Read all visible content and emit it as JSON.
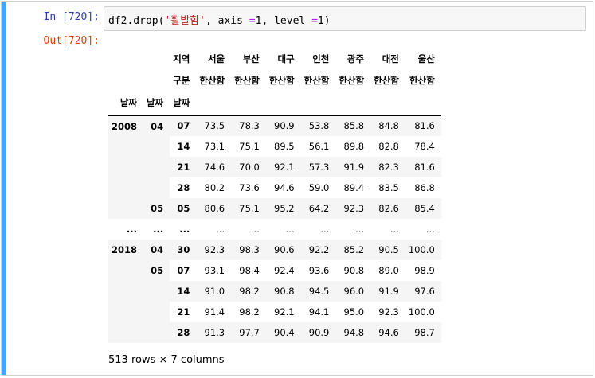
{
  "cell": {
    "in_prompt": "In [720]:",
    "out_prompt": "Out[720]:",
    "code": {
      "pre": "df2.drop(",
      "str_arg": "'활발함'",
      "mid1": ", axis ",
      "op1": "=",
      "mid2": "1, level ",
      "op2": "=",
      "post": "1)"
    }
  },
  "table": {
    "col_level0_label": "지역",
    "col_level1_label": "구분",
    "regions": [
      "서울",
      "부산",
      "대구",
      "인천",
      "광주",
      "대전",
      "울산"
    ],
    "measure": "한산함",
    "index_names": [
      "날짜",
      "날짜",
      "날짜"
    ],
    "rows": [
      {
        "y": "2008",
        "m": "04",
        "d": "07",
        "v": [
          "73.5",
          "78.3",
          "90.9",
          "53.8",
          "85.8",
          "84.8",
          "81.6"
        ]
      },
      {
        "y": "",
        "m": "",
        "d": "14",
        "v": [
          "73.1",
          "75.1",
          "89.5",
          "56.1",
          "89.8",
          "82.8",
          "78.4"
        ]
      },
      {
        "y": "",
        "m": "",
        "d": "21",
        "v": [
          "74.6",
          "70.0",
          "92.1",
          "57.3",
          "91.9",
          "82.3",
          "81.6"
        ]
      },
      {
        "y": "",
        "m": "",
        "d": "28",
        "v": [
          "80.2",
          "73.6",
          "94.6",
          "59.0",
          "89.4",
          "83.5",
          "86.8"
        ]
      },
      {
        "y": "",
        "m": "05",
        "d": "05",
        "v": [
          "80.6",
          "75.1",
          "95.2",
          "64.2",
          "92.3",
          "82.6",
          "85.4"
        ]
      },
      {
        "y": "...",
        "m": "...",
        "d": "...",
        "v": [
          "...",
          "...",
          "...",
          "...",
          "...",
          "...",
          "..."
        ]
      },
      {
        "y": "2018",
        "m": "04",
        "d": "30",
        "v": [
          "92.3",
          "98.3",
          "90.6",
          "92.2",
          "85.2",
          "90.5",
          "100.0"
        ]
      },
      {
        "y": "",
        "m": "05",
        "d": "07",
        "v": [
          "93.1",
          "98.4",
          "92.4",
          "93.6",
          "90.8",
          "89.0",
          "98.9"
        ]
      },
      {
        "y": "",
        "m": "",
        "d": "14",
        "v": [
          "91.0",
          "98.2",
          "90.8",
          "94.5",
          "96.0",
          "91.9",
          "97.6"
        ]
      },
      {
        "y": "",
        "m": "",
        "d": "21",
        "v": [
          "91.4",
          "98.2",
          "92.1",
          "94.1",
          "95.0",
          "92.3",
          "100.0"
        ]
      },
      {
        "y": "",
        "m": "",
        "d": "28",
        "v": [
          "91.3",
          "97.7",
          "90.4",
          "90.9",
          "94.8",
          "94.6",
          "98.7"
        ]
      }
    ],
    "summary": "513 rows × 7 columns"
  }
}
